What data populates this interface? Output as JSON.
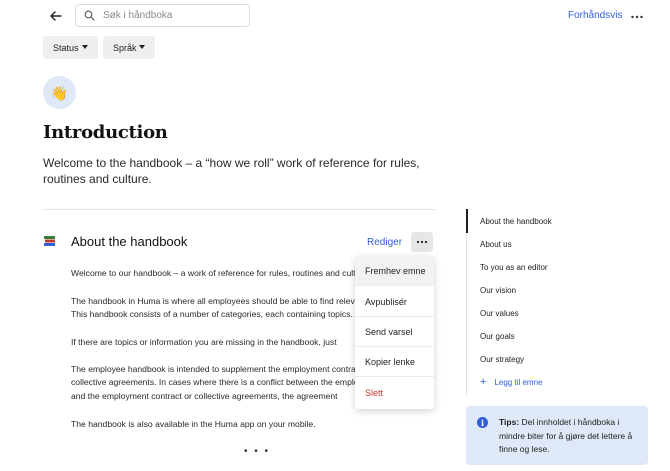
{
  "header": {
    "search_placeholder": "Søk i håndboka",
    "preview_label": "Forhåndsvis"
  },
  "filters": {
    "status_label": "Status",
    "language_label": "Språk"
  },
  "page": {
    "emoji": "👋",
    "title": "Introduction",
    "subtitle": "Welcome to the handbook – a “how we roll” work of reference for rules, routines and culture."
  },
  "section": {
    "title": "About the handbook",
    "edit_label": "Rediger",
    "paragraphs": [
      "Welcome to our handbook – a work of reference for rules, routines and culture.",
      "The handbook in Huma is where all employees should be able to find relevant information.",
      "This handbook consists of a number of categories, each containing topics.",
      "If there are topics or information you are missing in the handbook, just",
      "The employee handbook is intended to supplement the employment contract and",
      "collective agreements. In cases where there is a conflict between the employee handbook",
      "and the employment contract or collective agreements, the agreement",
      "The handbook is also available in the Huma app on your mobile."
    ],
    "more_indicator": "• • •"
  },
  "context_menu": {
    "items": [
      "Fremhev emne",
      "Avpublisér",
      "Send varsel",
      "Kopier lenke",
      "Slett"
    ]
  },
  "toc": {
    "items": [
      "About the handbook",
      "About us",
      "To you as an editor",
      "Our vision",
      "Our values",
      "Our goals",
      "Our strategy"
    ],
    "add_label": "Legg til emne"
  },
  "tip": {
    "label": "Tips:",
    "text": "Del innholdet i håndboka i mindre biter for å gjøre det lettere å finne og lese."
  },
  "colors": {
    "accent": "#2f5fd6",
    "danger": "#c0392b",
    "tip_background": "#dfe8f6"
  }
}
